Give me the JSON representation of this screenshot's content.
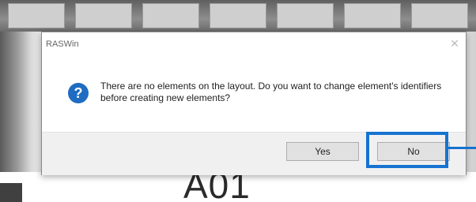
{
  "dialog": {
    "title": "RASWin",
    "close_glyph": "✕",
    "icon": "question-icon",
    "icon_glyph": "?",
    "message": "There are no elements on the layout. Do you want to change element's identifiers before creating new elements?",
    "buttons": {
      "yes": "Yes",
      "no": "No"
    }
  },
  "background": {
    "label": "A01"
  },
  "colors": {
    "highlight": "#1673d1",
    "icon": "#1f6cc2"
  }
}
